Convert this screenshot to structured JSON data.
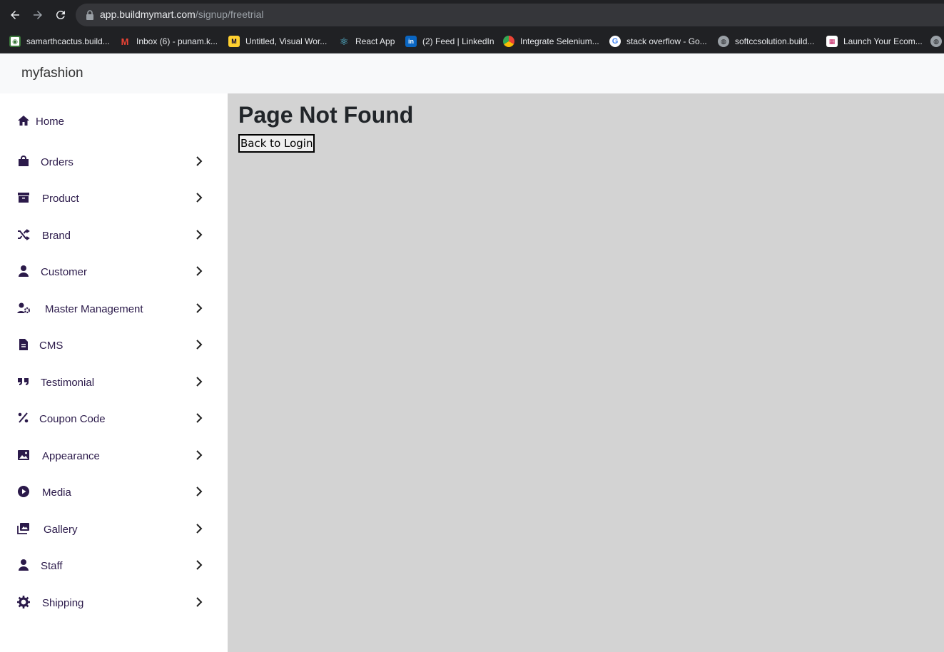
{
  "browser": {
    "url_host": "app.buildmymart.com",
    "url_path": "/signup/freetrial",
    "bookmarks": [
      {
        "label": "samarthcactus.build...",
        "icon": "cactus-favicon"
      },
      {
        "label": "Inbox (6) - punam.k...",
        "icon": "gmail-favicon"
      },
      {
        "label": "Untitled, Visual Wor...",
        "icon": "miro-favicon"
      },
      {
        "label": "React App",
        "icon": "react-favicon"
      },
      {
        "label": "(2) Feed | LinkedIn",
        "icon": "linkedin-favicon"
      },
      {
        "label": "Integrate Selenium...",
        "icon": "chrome-favicon"
      },
      {
        "label": "stack overflow - Go...",
        "icon": "google-favicon"
      },
      {
        "label": "softccsolution.build...",
        "icon": "globe-favicon"
      },
      {
        "label": "Launch Your Ecom...",
        "icon": "store-favicon"
      }
    ]
  },
  "app": {
    "brand": "myfashion"
  },
  "sidebar": {
    "items": [
      {
        "label": "Home",
        "icon": "home-icon"
      },
      {
        "label": "Orders",
        "icon": "shopping-bag-icon"
      },
      {
        "label": "Product",
        "icon": "archive-box-icon"
      },
      {
        "label": "Brand",
        "icon": "shuffle-icon"
      },
      {
        "label": "Customer",
        "icon": "user-icon"
      },
      {
        "label": "Master Management",
        "icon": "user-gear-icon"
      },
      {
        "label": "CMS",
        "icon": "document-icon"
      },
      {
        "label": "Testimonial",
        "icon": "quote-icon"
      },
      {
        "label": "Coupon Code",
        "icon": "percent-icon"
      },
      {
        "label": "Appearance",
        "icon": "image-icon"
      },
      {
        "label": "Media",
        "icon": "play-circle-icon"
      },
      {
        "label": "Gallery",
        "icon": "images-icon"
      },
      {
        "label": "Staff",
        "icon": "user-icon"
      },
      {
        "label": "Shipping",
        "icon": "gear-icon"
      }
    ]
  },
  "main": {
    "title": "Page Not Found",
    "back_label": "Back to Login"
  },
  "colors": {
    "chrome_bg": "#202124",
    "omnibox_bg": "#35363a",
    "header_bg": "#f8f9fa",
    "main_bg": "#d3d3d3",
    "sidebar_icon": "#2b1a4a"
  }
}
